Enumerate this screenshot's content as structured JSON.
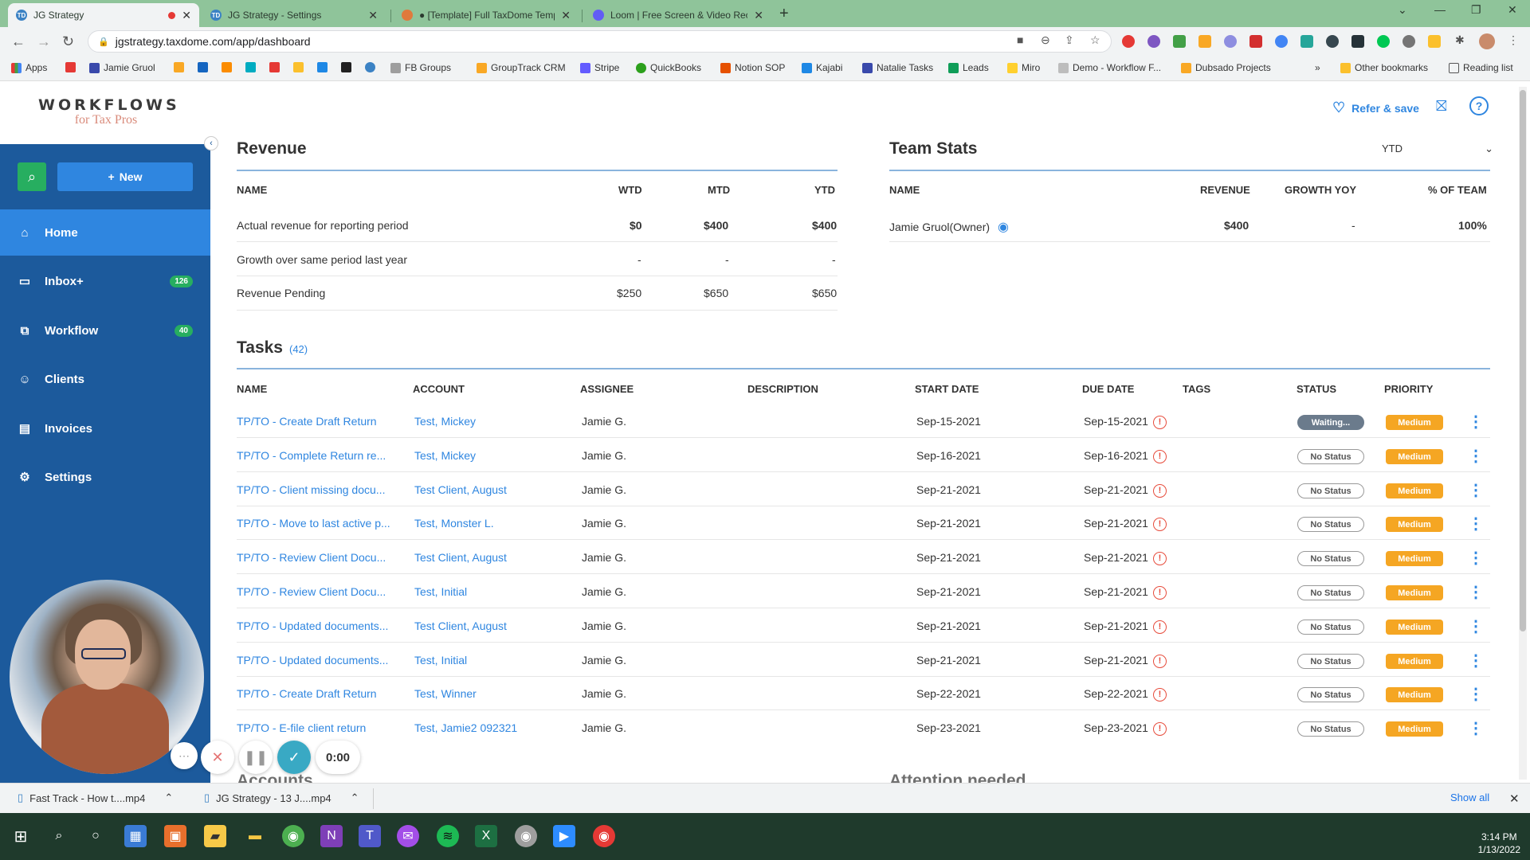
{
  "browser": {
    "tabs": [
      {
        "title": "JG Strategy",
        "favicon": "TD"
      },
      {
        "title": "JG Strategy - Settings",
        "favicon": "TD"
      },
      {
        "title": "● [Template] Full TaxDome Temp",
        "favicon": ""
      },
      {
        "title": "Loom | Free Screen & Video Rec",
        "favicon": ""
      }
    ],
    "url": "jgstrategy.taxdome.com/app/dashboard",
    "bookmarks": [
      "Apps",
      "Jamie Gruol",
      "FB Groups",
      "GroupTrack CRM",
      "Stripe",
      "QuickBooks",
      "Notion SOP",
      "Kajabi",
      "Natalie Tasks",
      "Leads",
      "Miro",
      "Demo - Workflow F...",
      "Dubsado Projects",
      "Other bookmarks",
      "Reading list"
    ],
    "bookmarks_more": "»"
  },
  "logo": {
    "line1": "WORKFLOWS",
    "line2": "for Tax Pros"
  },
  "header": {
    "refer": "Refer & save"
  },
  "sidebar": {
    "new_label": "New",
    "items": [
      {
        "label": "Home",
        "icon": "home-icon",
        "badge": ""
      },
      {
        "label": "Inbox+",
        "icon": "inbox-icon",
        "badge": "126"
      },
      {
        "label": "Workflow",
        "icon": "workflow-icon",
        "badge": "40"
      },
      {
        "label": "Clients",
        "icon": "clients-icon",
        "badge": ""
      },
      {
        "label": "Invoices",
        "icon": "invoices-icon",
        "badge": ""
      },
      {
        "label": "Settings",
        "icon": "gear-icon",
        "badge": ""
      }
    ]
  },
  "revenue": {
    "title": "Revenue",
    "headers": [
      "NAME",
      "WTD",
      "MTD",
      "YTD"
    ],
    "rows": [
      {
        "name": "Actual revenue for reporting period",
        "wtd": "$0",
        "mtd": "$400",
        "ytd": "$400"
      },
      {
        "name": "Growth over same period last year",
        "wtd": "-",
        "mtd": "-",
        "ytd": "-"
      },
      {
        "name": "Revenue Pending",
        "wtd": "$250",
        "mtd": "$650",
        "ytd": "$650"
      }
    ]
  },
  "team": {
    "title": "Team Stats",
    "period": "YTD",
    "headers": [
      "NAME",
      "REVENUE",
      "GROWTH YOY",
      "% OF TEAM"
    ],
    "rows": [
      {
        "name": "Jamie Gruol(Owner)",
        "revenue": "$400",
        "growth": "-",
        "pct": "100%"
      }
    ]
  },
  "tasks": {
    "title": "Tasks",
    "count": "(42)",
    "headers": [
      "NAME",
      "ACCOUNT",
      "ASSIGNEE",
      "DESCRIPTION",
      "START DATE",
      "DUE DATE",
      "TAGS",
      "STATUS",
      "PRIORITY"
    ],
    "rows": [
      {
        "name": "TP/TO - Create Draft Return",
        "account": "Test, Mickey",
        "assignee": "Jamie G.",
        "start": "Sep-15-2021",
        "due": "Sep-15-2021",
        "status": "Waiting...",
        "priority": "Medium"
      },
      {
        "name": "TP/TO - Complete Return re...",
        "account": "Test, Mickey",
        "assignee": "Jamie G.",
        "start": "Sep-16-2021",
        "due": "Sep-16-2021",
        "status": "No Status",
        "priority": "Medium"
      },
      {
        "name": "TP/TO - Client missing docu...",
        "account": "Test Client, August",
        "assignee": "Jamie G.",
        "start": "Sep-21-2021",
        "due": "Sep-21-2021",
        "status": "No Status",
        "priority": "Medium"
      },
      {
        "name": "TP/TO - Move to last active p...",
        "account": "Test, Monster L.",
        "assignee": "Jamie G.",
        "start": "Sep-21-2021",
        "due": "Sep-21-2021",
        "status": "No Status",
        "priority": "Medium"
      },
      {
        "name": "TP/TO - Review Client Docu...",
        "account": "Test Client, August",
        "assignee": "Jamie G.",
        "start": "Sep-21-2021",
        "due": "Sep-21-2021",
        "status": "No Status",
        "priority": "Medium"
      },
      {
        "name": "TP/TO - Review Client Docu...",
        "account": "Test, Initial",
        "assignee": "Jamie G.",
        "start": "Sep-21-2021",
        "due": "Sep-21-2021",
        "status": "No Status",
        "priority": "Medium"
      },
      {
        "name": "TP/TO - Updated documents...",
        "account": "Test Client, August",
        "assignee": "Jamie G.",
        "start": "Sep-21-2021",
        "due": "Sep-21-2021",
        "status": "No Status",
        "priority": "Medium"
      },
      {
        "name": "TP/TO - Updated documents...",
        "account": "Test, Initial",
        "assignee": "Jamie G.",
        "start": "Sep-21-2021",
        "due": "Sep-21-2021",
        "status": "No Status",
        "priority": "Medium"
      },
      {
        "name": "TP/TO - Create Draft Return",
        "account": "Test, Winner",
        "assignee": "Jamie G.",
        "start": "Sep-22-2021",
        "due": "Sep-22-2021",
        "status": "No Status",
        "priority": "Medium"
      },
      {
        "name": "TP/TO - E-file client return",
        "account": "Test, Jamie2 092321",
        "assignee": "Jamie G.",
        "start": "Sep-23-2021",
        "due": "Sep-23-2021",
        "status": "No Status",
        "priority": "Medium"
      }
    ]
  },
  "below": {
    "accounts": "Accounts",
    "attention": "Attention needed"
  },
  "loom": {
    "timer": "0:00"
  },
  "downloads": {
    "items": [
      "Fast Track - How t....mp4",
      "JG Strategy - 13 J....mp4"
    ],
    "show_all": "Show all"
  },
  "clock": {
    "time": "3:14 PM",
    "date": "1/13/2022"
  },
  "colors": {
    "sidebar": "#1c5a9c",
    "accent": "#2f86e0",
    "badge": "#27ae60",
    "priority": "#f5a623",
    "warning": "#e74c3c"
  }
}
